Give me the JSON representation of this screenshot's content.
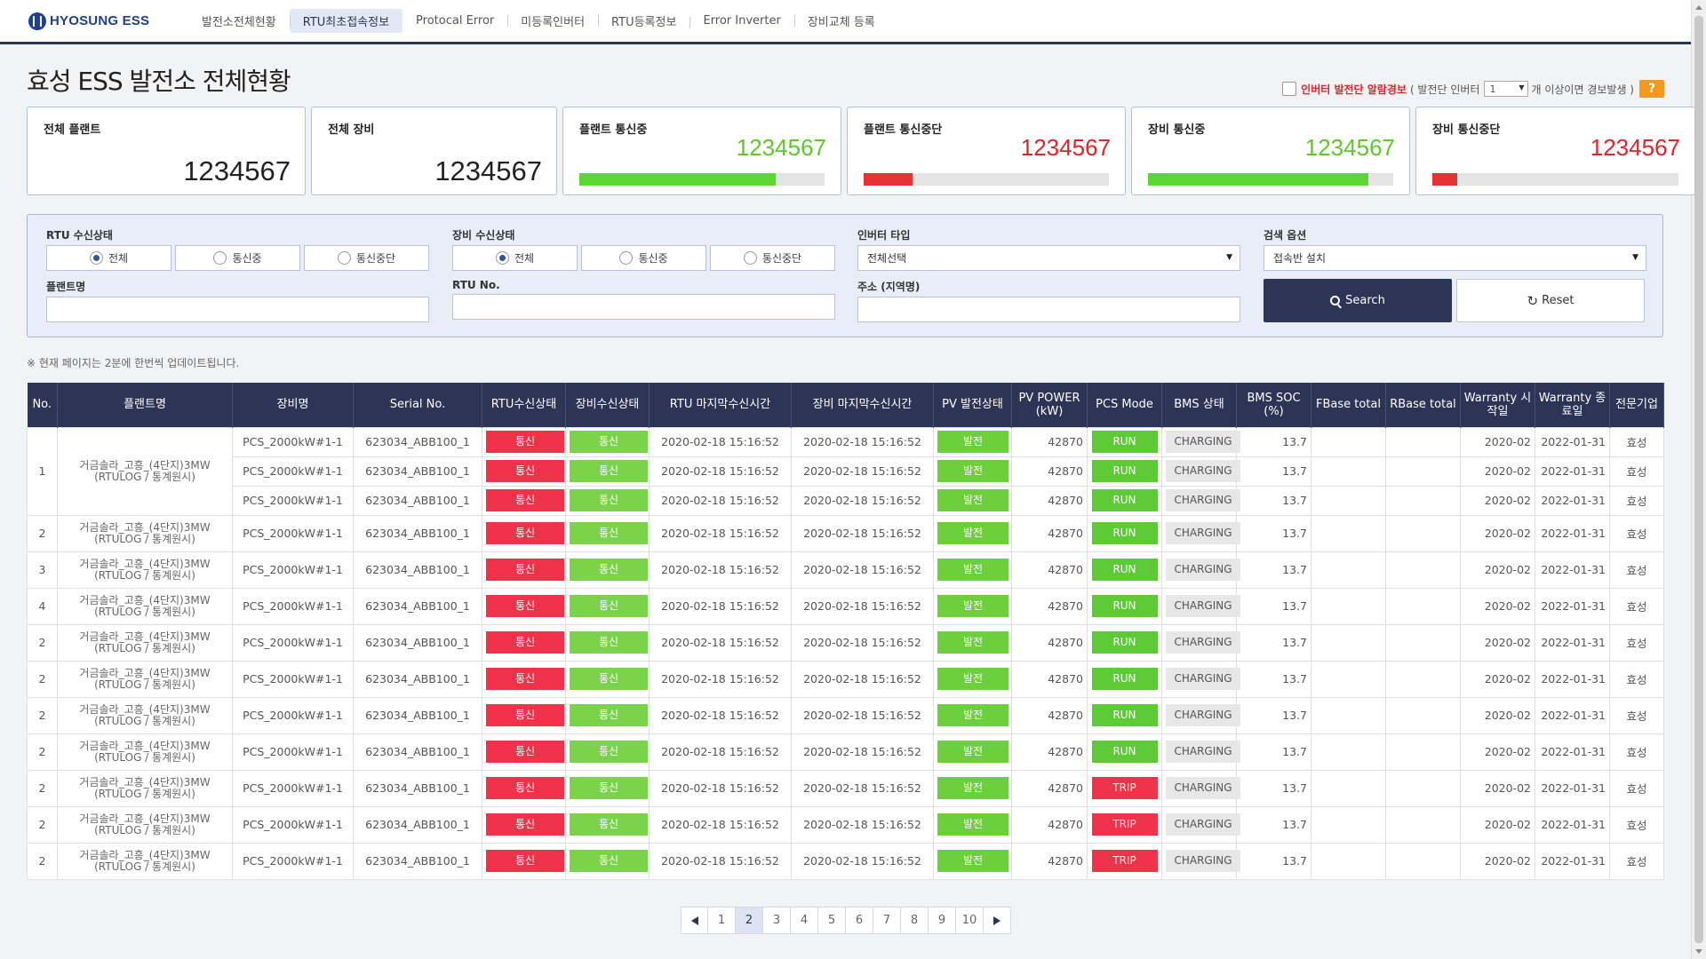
{
  "brand": {
    "name": "HYOSUNG ESS"
  },
  "nav": [
    "발전소전체현황",
    "RTU최초접속정보",
    "Protocal Error",
    "미등록인버터",
    "RTU등록정보",
    "Error Inverter",
    "장비교체 등록"
  ],
  "nav_active": 1,
  "page_title": "효성 ESS 발전소 전체현황",
  "alarm": {
    "label": "인버터 발전단 알람경보",
    "prefix": "( 발전단 인버터",
    "value": "1",
    "suffix": "개 이상이면 경보발생 )",
    "help": "?"
  },
  "kpis": [
    {
      "title": "전체 플랜트",
      "value": "1234567"
    },
    {
      "title": "전체 장비",
      "value": "1234567"
    },
    {
      "title": "플랜트 통신중",
      "value": "1234567",
      "ratio": 0.8
    },
    {
      "title": "플랜트 통신중단",
      "value": "1234567",
      "ratio": 0.2
    },
    {
      "title": "장비 통신중",
      "value": "1234567",
      "ratio": 0.9
    },
    {
      "title": "장비 통신중단",
      "value": "1234567",
      "ratio": 0.1
    }
  ],
  "filters": {
    "rtu_label": "RTU 수신상태",
    "device_label": "장비 수신상태",
    "radio_options": [
      "전체",
      "통신중",
      "통신중단"
    ],
    "inverter_label": "인버터 타입",
    "inverter_value": "전체선택",
    "search_option_label": "검색 옵션",
    "search_option_value": "접속반 설치",
    "plant_label": "플랜트명",
    "rtu_no_label": "RTU No.",
    "address_label": "주소 (지역명)",
    "search_btn": "Search",
    "reset_btn": "Reset"
  },
  "notice": "※ 현재 페이지는 2분에 한번씩 업데이트됩니다.",
  "table": {
    "headers": [
      "No.",
      "플랜트명",
      "장비명",
      "Serial No.",
      "RTU수신상태",
      "장비수신상태",
      "RTU 마지막수신시간",
      "장비 마지막수신시간",
      "PV 발전상태",
      "PV POWER (kW)",
      "PCS Mode",
      "BMS 상태",
      "BMS SOC (%)",
      "FBase total",
      "RBase total",
      "Warranty 시작일",
      "Warranty 종료일",
      "전문기업"
    ],
    "plant_line1": "거금솔라_고흥_(4단지)3MW",
    "plant_line2": "(RTULOG / 통계원시)",
    "device": "PCS_2000kW#1-1",
    "serial": "623034_ABB100_1",
    "rtu_status": "통신",
    "dev_status": "통신",
    "rtu_time": "2020-02-18 15:16:52",
    "dev_time": "2020-02-18 15:16:52",
    "pv_status": "발전",
    "pv_power": "42870",
    "bms_state": "CHARGING",
    "bms_soc": "13.7",
    "w_start": "2020-02",
    "w_end": "2022-01-31",
    "company": "효성",
    "rows": [
      {
        "no": "1",
        "sub": 3,
        "pcs": [
          "RUN",
          "RUN",
          "RUN"
        ]
      },
      {
        "no": "2",
        "pcs": [
          "RUN"
        ]
      },
      {
        "no": "3",
        "pcs": [
          "RUN"
        ]
      },
      {
        "no": "4",
        "pcs": [
          "RUN"
        ]
      },
      {
        "no": "2",
        "pcs": [
          "RUN"
        ]
      },
      {
        "no": "2",
        "pcs": [
          "RUN"
        ]
      },
      {
        "no": "2",
        "pcs": [
          "RUN"
        ]
      },
      {
        "no": "2",
        "pcs": [
          "RUN"
        ]
      },
      {
        "no": "2",
        "pcs": [
          "TRIP"
        ]
      },
      {
        "no": "2",
        "pcs": [
          "TRIP"
        ]
      },
      {
        "no": "2",
        "pcs": [
          "TRIP"
        ]
      }
    ]
  },
  "pagination": {
    "pages": [
      "1",
      "2",
      "3",
      "4",
      "5",
      "6",
      "7",
      "8",
      "9",
      "10"
    ],
    "active": "2"
  }
}
